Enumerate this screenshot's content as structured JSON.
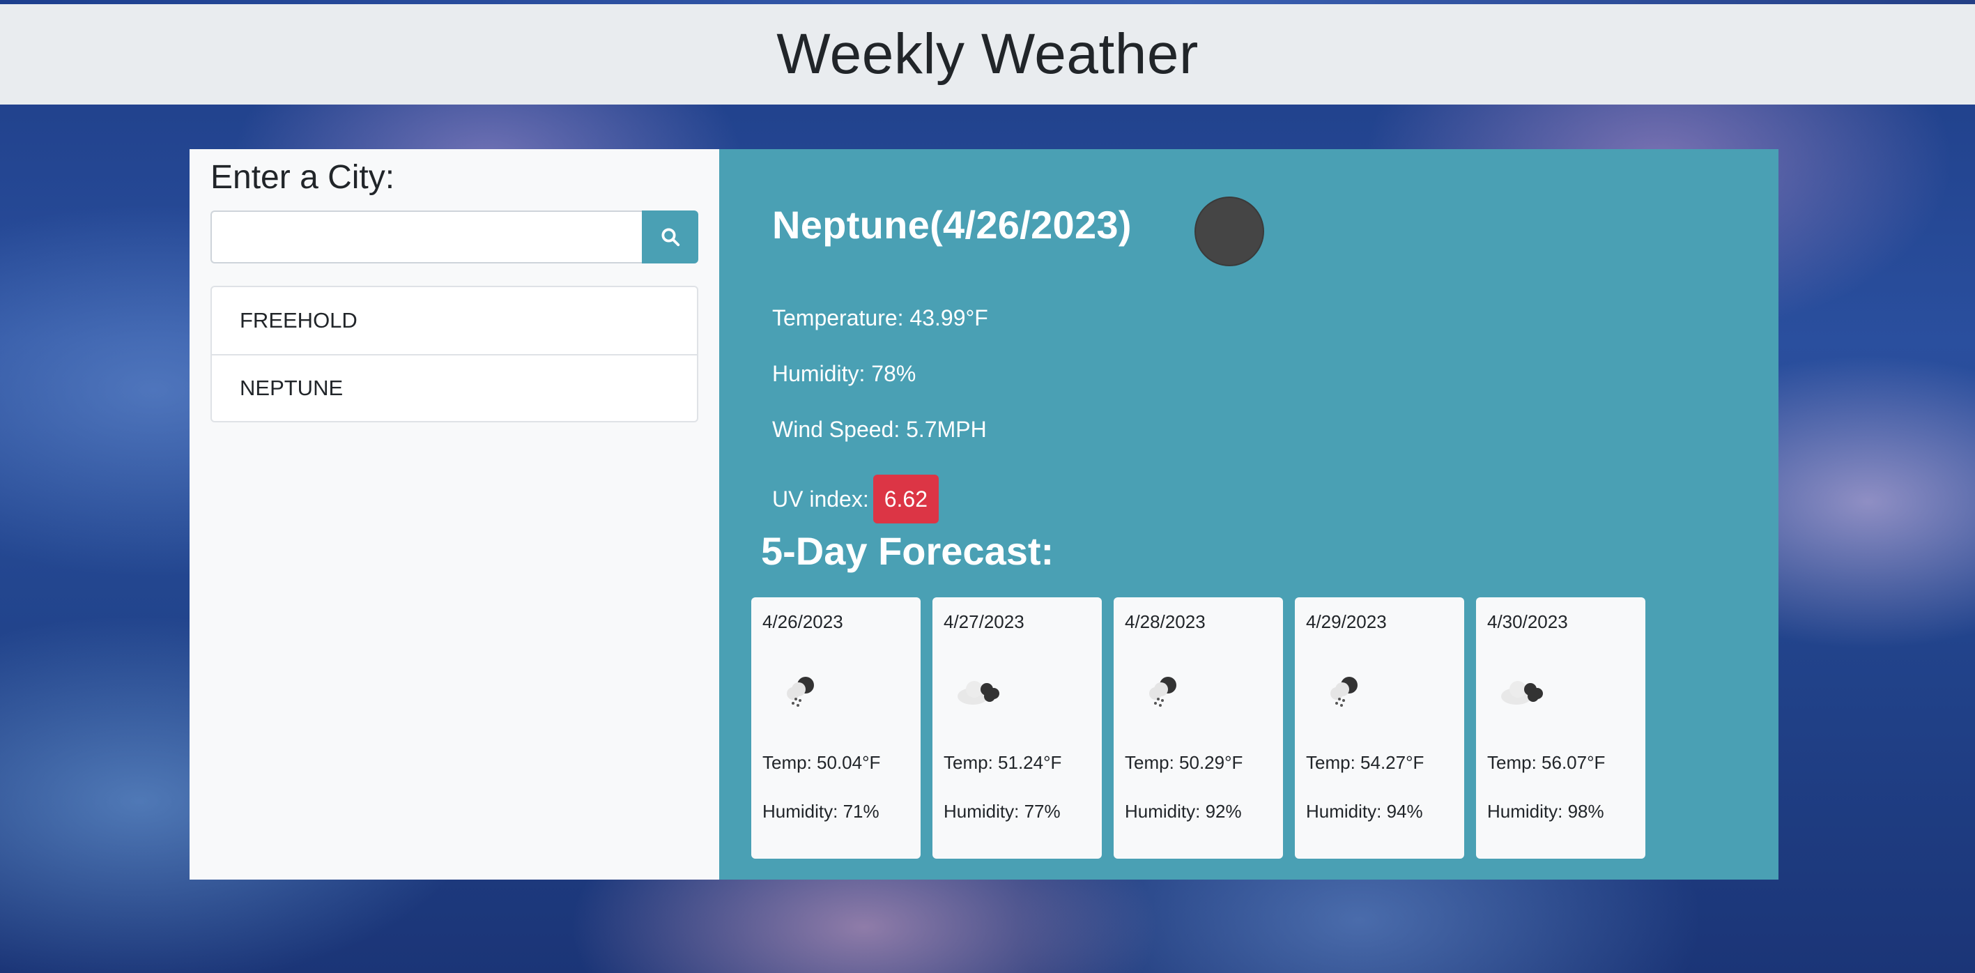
{
  "header": {
    "title": "Weekly Weather"
  },
  "sidebar": {
    "heading": "Enter a City:",
    "search": {
      "value": "",
      "placeholder": ""
    },
    "search_button_icon": "search-icon",
    "history": [
      "FREEHOLD",
      "NEPTUNE"
    ]
  },
  "current": {
    "city_date": "Neptune(4/26/2023)",
    "weather_icon": "weather-icon",
    "temperature": "Temperature: 43.99°F",
    "humidity": "Humidity: 78%",
    "wind": "Wind Speed: 5.7MPH",
    "uv_label": "UV index:",
    "uv_value": "6.62"
  },
  "forecast": {
    "title": "5-Day Forecast:",
    "days": [
      {
        "date": "4/26/2023",
        "icon": "rain-cloud-icon",
        "temp": "Temp: 50.04°F",
        "humidity": "Humidity: 71%"
      },
      {
        "date": "4/27/2023",
        "icon": "cloudy-icon",
        "temp": "Temp: 51.24°F",
        "humidity": "Humidity: 77%"
      },
      {
        "date": "4/28/2023",
        "icon": "rain-cloud-icon",
        "temp": "Temp: 50.29°F",
        "humidity": "Humidity: 92%"
      },
      {
        "date": "4/29/2023",
        "icon": "rain-cloud-icon",
        "temp": "Temp: 54.27°F",
        "humidity": "Humidity: 94%"
      },
      {
        "date": "4/30/2023",
        "icon": "cloudy-icon",
        "temp": "Temp: 56.07°F",
        "humidity": "Humidity: 98%"
      }
    ]
  },
  "colors": {
    "main_panel": "#4aa0b4",
    "uv_badge": "#dc3545",
    "header_bg": "#e9ecef",
    "sidebar_bg": "#f8f9fa"
  }
}
